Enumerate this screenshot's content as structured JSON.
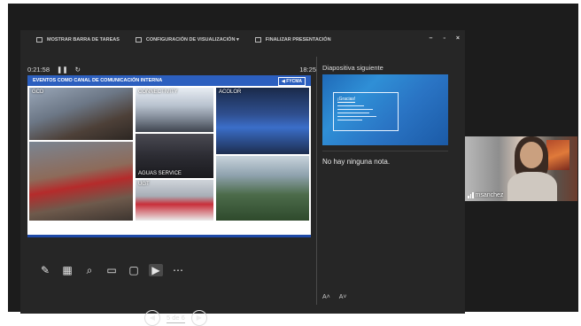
{
  "toolbar": {
    "items": [
      {
        "label": "MOSTRAR BARRA DE TAREAS"
      },
      {
        "label": "CONFIGURACIÓN DE VISUALIZACIÓN ▾"
      },
      {
        "label": "FINALIZAR PRESENTACIÓN"
      }
    ]
  },
  "window_controls": {
    "minimize": "–",
    "restore": "▫",
    "close": "×"
  },
  "timer": {
    "elapsed": "0:21:58",
    "pause": "❚❚",
    "reset": "↻",
    "clock": "18:25"
  },
  "slide": {
    "header": "EVENTOS COMO CANAL DE COMUNICACIÓN INTERNA",
    "logo": "◀ FYCMA",
    "photo_labels": [
      "GCD",
      "CONNECTIVITY",
      "ACOLOR",
      "AGUAS SERVICE",
      "",
      "UGT",
      ""
    ]
  },
  "tools": [
    "✎",
    "▦",
    "⌕",
    "▭",
    "▢",
    "▶",
    "⋯"
  ],
  "nav": {
    "prev": "◀",
    "counter": "5 de 6",
    "next": "▶"
  },
  "next_slide": {
    "label": "Diapositiva siguiente",
    "thumb_title": "¡Gracias!"
  },
  "notes": {
    "text": "No hay ninguna nota."
  },
  "font_controls": {
    "increase": "A˄",
    "decrease": "A˅"
  },
  "participant": {
    "name": "msanchez"
  }
}
